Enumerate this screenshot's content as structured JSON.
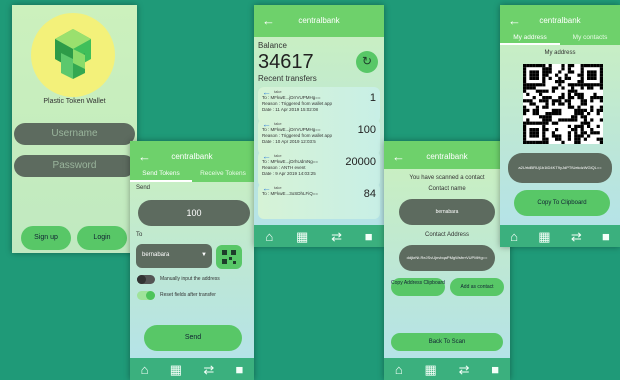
{
  "login": {
    "app_name": "Plastic Token Wallet",
    "username_placeholder": "Username",
    "password_placeholder": "Password",
    "signup_label": "Sign up",
    "login_label": "Login"
  },
  "send_screen": {
    "title": "centralbank",
    "tabs": [
      "Send Tokens",
      "Receive Tokens"
    ],
    "send_label": "Send",
    "amount": "100",
    "to_label": "To",
    "recipient": "bernabara",
    "manual_label": "Manually input the address",
    "reset_label": "Reset fields after transfer",
    "send_button": "Send"
  },
  "balance_screen": {
    "title": "centralbank",
    "balance_label": "Balance",
    "balance": "34617",
    "recent_label": "Recent transfers",
    "transfers": [
      {
        "dir": "take",
        "to": "To : MFkwE...jDrrVUPMHg==",
        "reason": "Reason : Triggered from wallet app",
        "date": "Date : 11 Apr 2019 15:02:08",
        "amount": "1"
      },
      {
        "dir": "take",
        "to": "To : MFkwE...jDrrVUPMHg==",
        "reason": "Reason : Triggered from wallet app",
        "date": "Date : 10 Apr 2019 12:03:5",
        "amount": "100"
      },
      {
        "dir": "take",
        "to": "To : MFkwE...jDrhUdmNg==",
        "reason": "Reason : ANTH event",
        "date": "Date : 9 Apr 2019 14:03:25",
        "amount": "20000"
      },
      {
        "dir": "take",
        "to": "To : MFkwE...3oSDhLFiQ==",
        "reason": "",
        "date": "",
        "amount": "84"
      }
    ]
  },
  "scan_screen": {
    "title": "centralbank",
    "scanned_msg": "You have scanned a contact",
    "contact_name_label": "Contact name",
    "contact_name": "bernabara",
    "contact_address_label": "Contact Address",
    "contact_address": "ddjkrNt.ReJSvUjnvbqaPMgWsfrrrVUPMHg==",
    "copy_button": "Copy Address Clipboard",
    "add_contact_button": "Add as contact",
    "back_button": "Back To Scan"
  },
  "address_screen": {
    "title": "centralbank",
    "tabs": [
      "My address",
      "My contacts"
    ],
    "my_address_label": "My address",
    "address": "a2UrtdBRUj1b1tD4KT9yJdPTfUekdzWGiQL==",
    "copy_button": "Copy To Clipboard"
  },
  "nav_icons": [
    "home-icon",
    "qr-icon",
    "transfer-icon",
    "contacts-icon"
  ],
  "colors": {
    "accent": "#6ed16b",
    "nav": "#3bb07e",
    "background": "#1f9a78",
    "input": "#5d6b5f"
  }
}
